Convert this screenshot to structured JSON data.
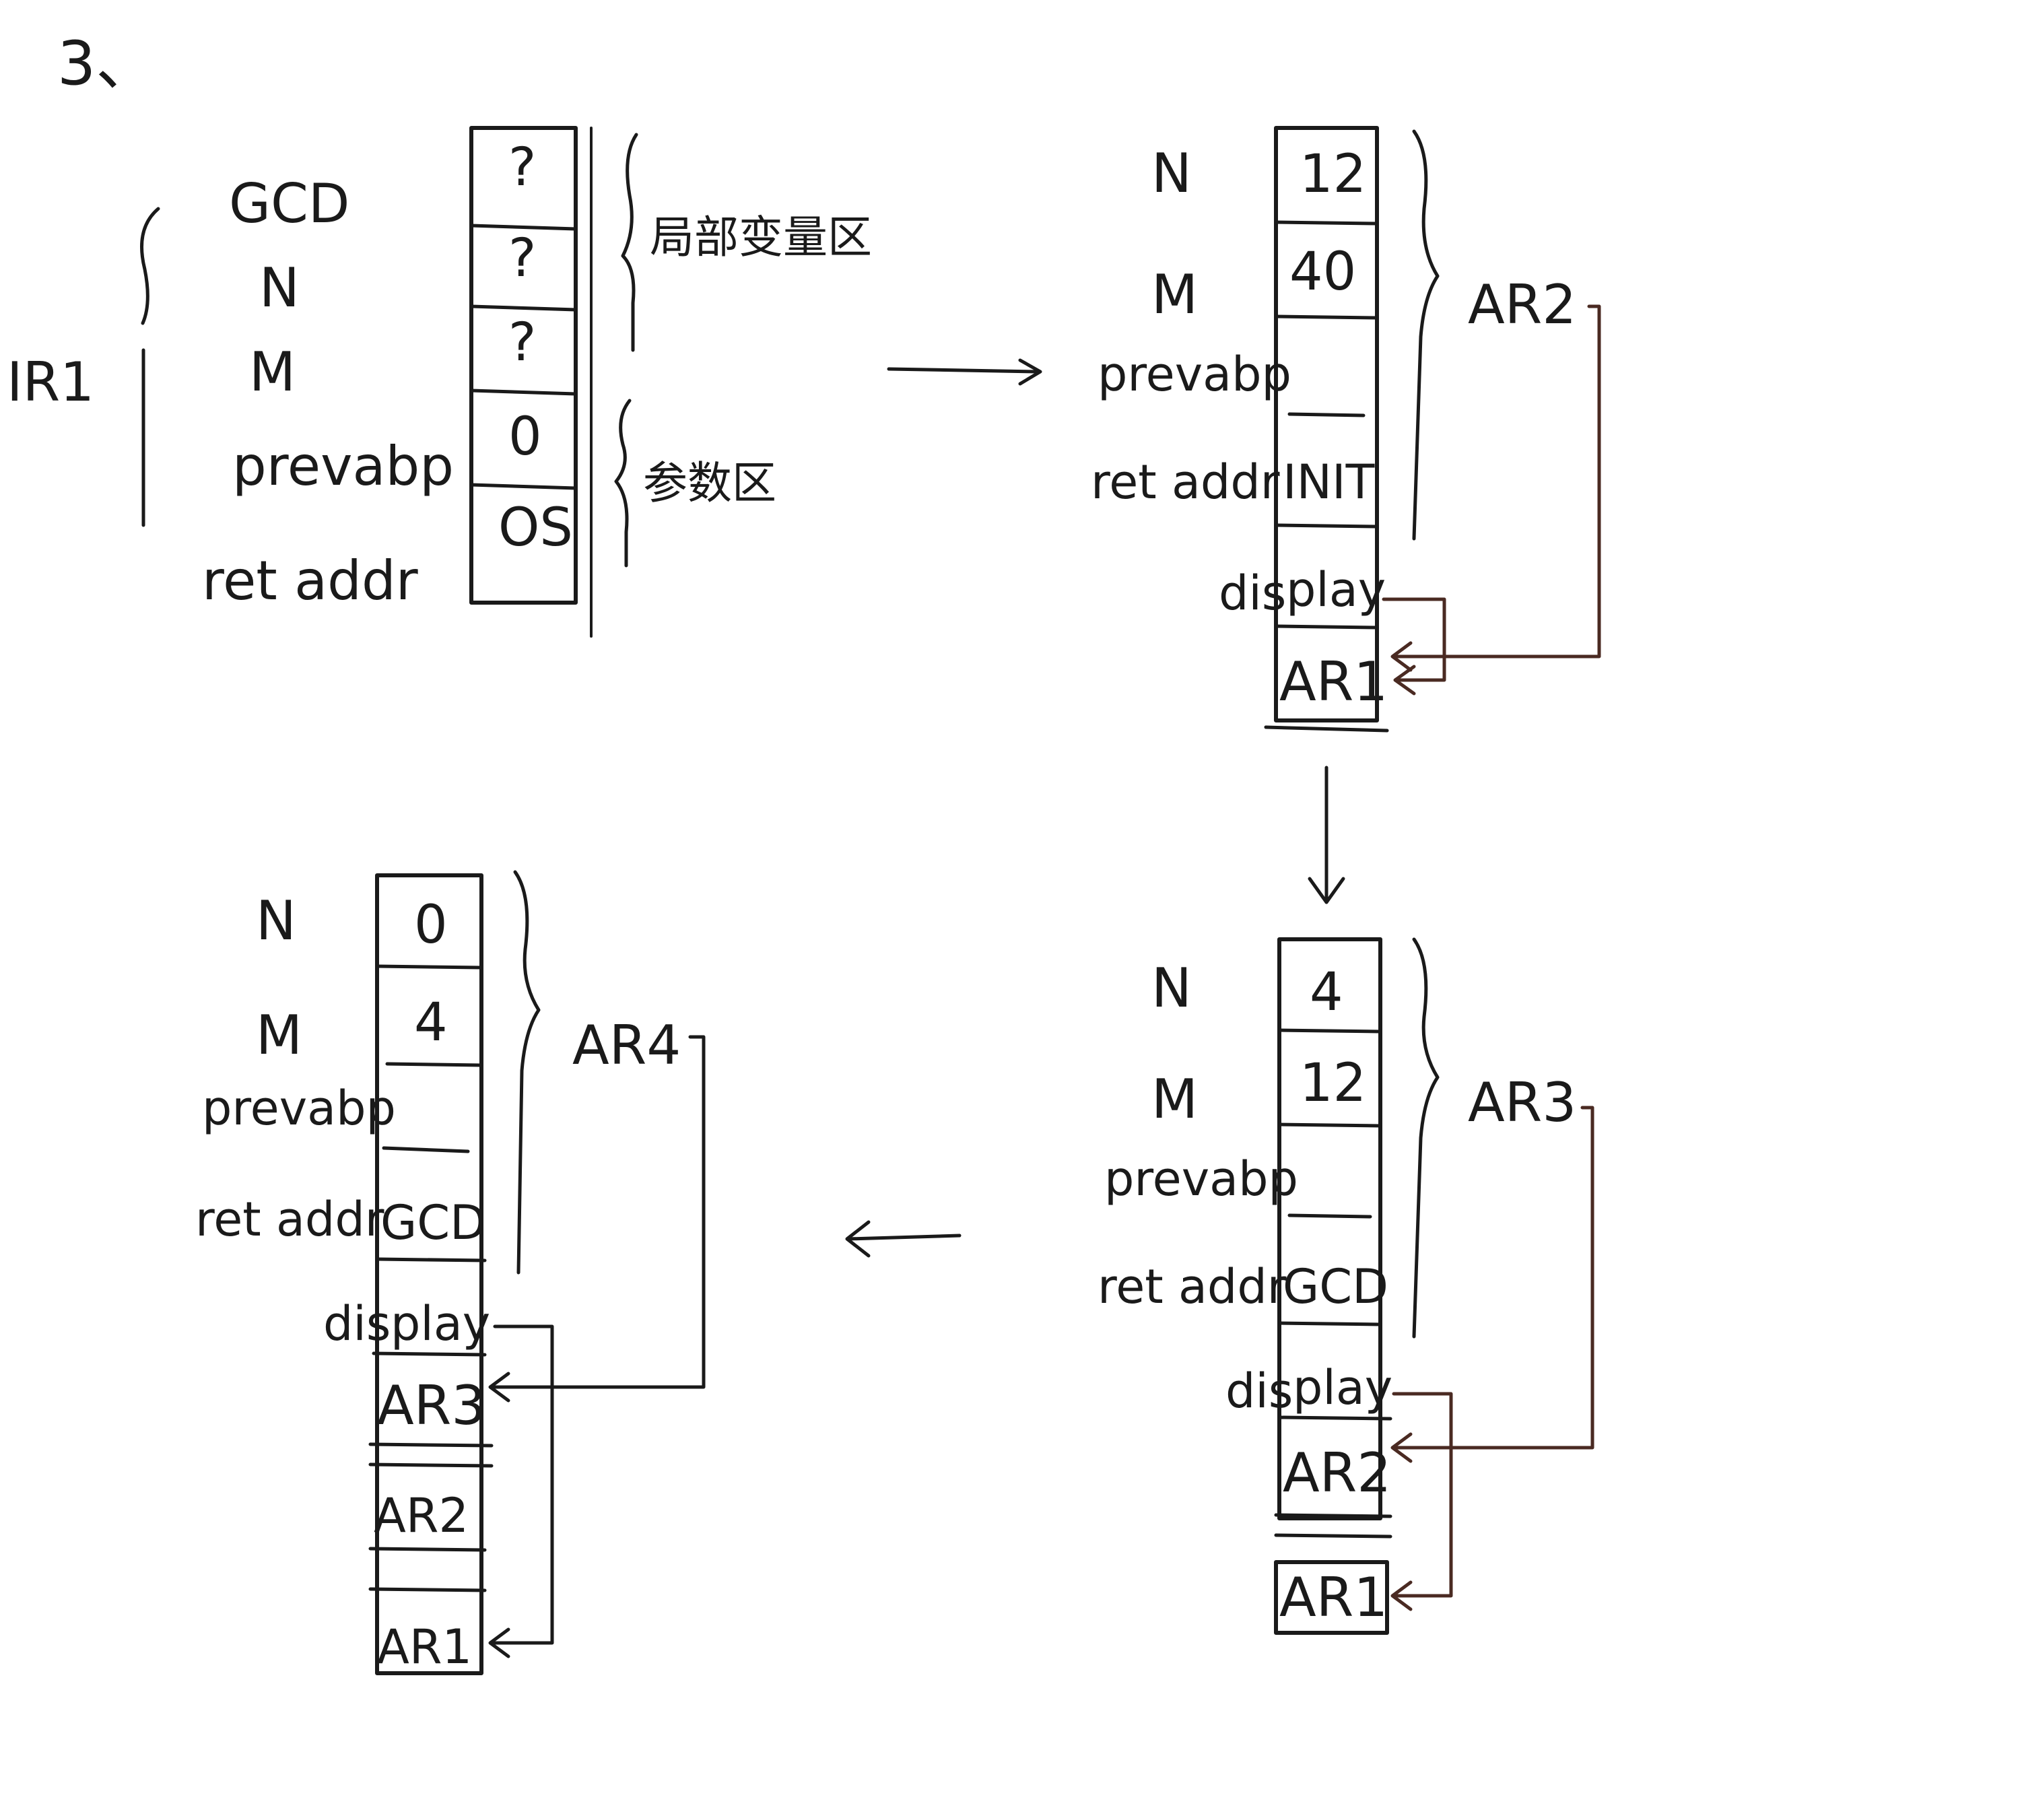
{
  "page": {
    "number": "3、"
  },
  "ar1": {
    "name": "IR1",
    "rows": [
      {
        "label": "GCD",
        "value": "?"
      },
      {
        "label": "N",
        "value": "?"
      },
      {
        "label": "M",
        "value": "?"
      },
      {
        "label": "prevabp",
        "value": "0"
      },
      {
        "label": "ret addr",
        "value": "OS"
      }
    ],
    "brace_global": "局部变量区",
    "brace_params": "参数区"
  },
  "ar2": {
    "name": "AR2",
    "labels": {
      "n": "N",
      "m": "M",
      "prev": "prevabp",
      "ret": "ret addr",
      "disp_a": "dis",
      "disp_b": "play"
    },
    "values": {
      "n": "12",
      "m": "40",
      "ret": "INIT"
    },
    "display": [
      "AR1"
    ]
  },
  "ar3": {
    "name": "AR3",
    "labels": {
      "n": "N",
      "m": "M",
      "prev": "prevabp",
      "ret": "ret addr",
      "disp_a": "dis",
      "disp_b": "play"
    },
    "values": {
      "n": "4",
      "m": "12",
      "ret": "GCD"
    },
    "display": [
      "AR2",
      "AR1"
    ]
  },
  "ar4": {
    "name": "AR4",
    "labels": {
      "n": "N",
      "m": "M",
      "prev": "prevabp",
      "ret": "ret addr",
      "disp_a": "dis",
      "disp_b": "play"
    },
    "values": {
      "n": "0",
      "m": "4",
      "ret": "GCD"
    },
    "display": [
      "AR3",
      "AR2",
      "AR1"
    ]
  }
}
